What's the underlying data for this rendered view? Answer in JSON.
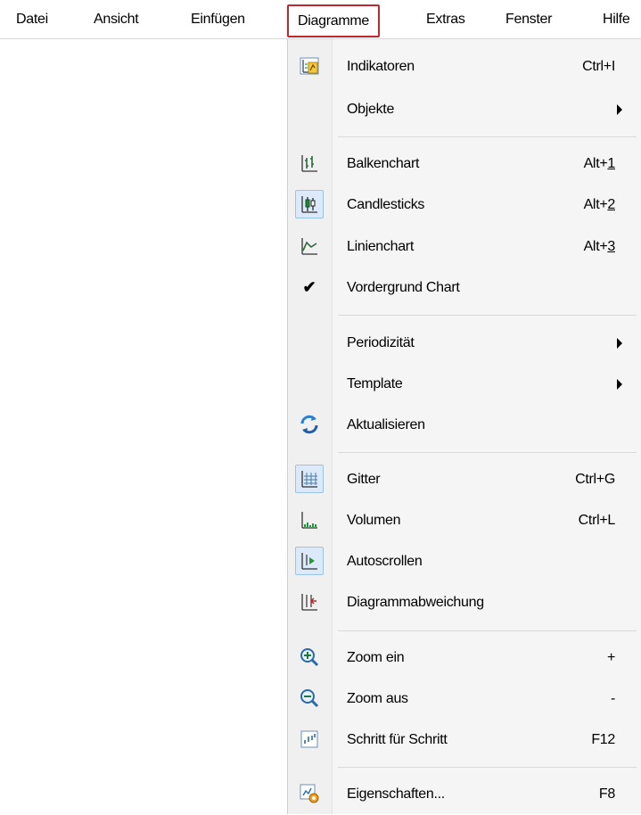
{
  "menubar": {
    "items": [
      {
        "label": "Datei"
      },
      {
        "label": "Ansicht"
      },
      {
        "label": "Einfügen"
      },
      {
        "label": "Diagramme"
      },
      {
        "label": "Extras"
      },
      {
        "label": "Fenster"
      },
      {
        "label": "Hilfe"
      }
    ],
    "highlight_color": "#c0282f"
  },
  "dropdown": {
    "items": [
      {
        "label": "Indikatoren",
        "shortcut": "Ctrl+I",
        "icon": "indicators-icon"
      },
      {
        "label": "Objekte",
        "submenu": true
      },
      {
        "label": "Balkenchart",
        "shortcut_prefix": "Alt+",
        "shortcut_key": "1",
        "icon": "bar-chart-icon"
      },
      {
        "label": "Candlesticks",
        "shortcut_prefix": "Alt+",
        "shortcut_key": "2",
        "icon": "candlesticks-icon",
        "selected": true
      },
      {
        "label": "Linienchart",
        "shortcut_prefix": "Alt+",
        "shortcut_key": "3",
        "icon": "line-chart-icon"
      },
      {
        "label": "Vordergrund Chart",
        "icon": "checkmark-icon",
        "checked": true
      },
      {
        "label": "Periodizität",
        "submenu": true
      },
      {
        "label": "Template",
        "submenu": true
      },
      {
        "label": "Aktualisieren",
        "icon": "refresh-icon"
      },
      {
        "label": "Gitter",
        "shortcut": "Ctrl+G",
        "icon": "grid-icon",
        "selected": true
      },
      {
        "label": "Volumen",
        "shortcut": "Ctrl+L",
        "icon": "volume-icon"
      },
      {
        "label": "Autoscrollen",
        "icon": "autoscroll-icon",
        "selected": true
      },
      {
        "label": "Diagrammabweichung",
        "icon": "chart-shift-icon"
      },
      {
        "label": "Zoom ein",
        "shortcut": "+",
        "icon": "zoom-in-icon"
      },
      {
        "label": "Zoom aus",
        "shortcut": "-",
        "icon": "zoom-out-icon"
      },
      {
        "label": "Schritt für Schritt",
        "shortcut": "F12",
        "icon": "step-by-step-icon"
      },
      {
        "label": "Eigenschaften...",
        "shortcut": "F8",
        "icon": "properties-icon"
      }
    ]
  }
}
